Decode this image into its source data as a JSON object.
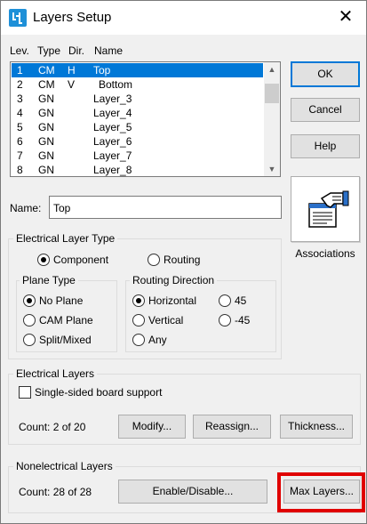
{
  "window": {
    "title": "Layers Setup",
    "close_glyph": "✕"
  },
  "list": {
    "headers": {
      "lev": "Lev.",
      "type": "Type",
      "dir": "Dir.",
      "name": "Name"
    },
    "rows": [
      {
        "lev": "1",
        "type": "CM",
        "dir": "H",
        "name": "Top",
        "selected": true
      },
      {
        "lev": "2",
        "type": "CM",
        "dir": "V",
        "name": "Bottom"
      },
      {
        "lev": "3",
        "type": "GN",
        "dir": "",
        "name": "Layer_3"
      },
      {
        "lev": "4",
        "type": "GN",
        "dir": "",
        "name": "Layer_4"
      },
      {
        "lev": "5",
        "type": "GN",
        "dir": "",
        "name": "Layer_5"
      },
      {
        "lev": "6",
        "type": "GN",
        "dir": "",
        "name": "Layer_6"
      },
      {
        "lev": "7",
        "type": "GN",
        "dir": "",
        "name": "Layer_7"
      },
      {
        "lev": "8",
        "type": "GN",
        "dir": "",
        "name": "Layer_8"
      }
    ]
  },
  "buttons": {
    "ok": "OK",
    "cancel": "Cancel",
    "help": "Help",
    "associations": "Associations",
    "modify": "Modify...",
    "reassign": "Reassign...",
    "thickness": "Thickness...",
    "enable_disable": "Enable/Disable...",
    "max_layers": "Max Layers..."
  },
  "name_field": {
    "label": "Name:",
    "value": "Top"
  },
  "electrical_layer_type": {
    "title": "Electrical  Layer Type",
    "component": "Component",
    "routing": "Routing",
    "selected": "component"
  },
  "plane_type": {
    "title": "Plane Type",
    "options": [
      "No Plane",
      "CAM Plane",
      "Split/Mixed"
    ],
    "selected": "No Plane"
  },
  "routing_direction": {
    "title": "Routing Direction",
    "horizontal": "Horizontal",
    "vertical": "Vertical",
    "any": "Any",
    "deg45": "45",
    "deg_minus45": "-45",
    "selected": "Horizontal"
  },
  "electrical_layers": {
    "title": "Electrical Layers",
    "single_sided": "Single-sided board support",
    "count": "Count:  2 of 20"
  },
  "nonelectrical_layers": {
    "title": "Nonelectrical Layers",
    "count": "Count: 28 of 28"
  },
  "colors": {
    "selection": "#0078d7",
    "highlight_box": "#e00000",
    "app_icon": "#1e90d8"
  }
}
